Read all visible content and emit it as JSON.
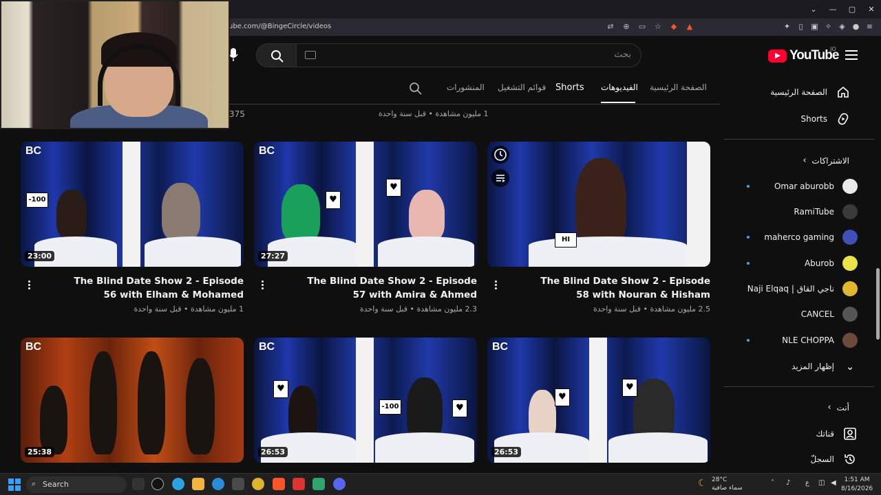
{
  "browser": {
    "url": "ube.com/@BingeCircle/videos",
    "window_controls": [
      "⌄",
      "—",
      "▢",
      "✕"
    ]
  },
  "youtube": {
    "logo_text": "YouTube",
    "country_code": "JO",
    "search_placeholder": "بحث",
    "tabs": [
      {
        "label": "الصفحة الرئيسية",
        "active": false
      },
      {
        "label": "الفيديوهات",
        "active": true
      },
      {
        "label": "Shorts",
        "active": false
      },
      {
        "label": "قوائم التشغيل",
        "active": false
      },
      {
        "label": "المنشورات",
        "active": false
      }
    ],
    "prev_row_meta": "1 مليون مشاهدة • قبل سنة واحدة",
    "prev_row_num": "375"
  },
  "sidebar": {
    "home_label": "الصفحة الرئيسية",
    "shorts_label": "Shorts",
    "subscriptions_header": "الاشتراكات",
    "subscriptions": [
      {
        "name": "Omar aburobb",
        "new": true,
        "color": "#e8e8e8"
      },
      {
        "name": "RamiTube",
        "new": false,
        "color": "#3a3a3a"
      },
      {
        "name": "maherco gaming",
        "new": true,
        "color": "#3f51b5"
      },
      {
        "name": "Aburob",
        "new": true,
        "color": "#e8e34a"
      },
      {
        "name": "Naji Elqaq | ناجي القاق",
        "new": false,
        "color": "#e0b72f"
      },
      {
        "name": "CANCEL",
        "new": false,
        "color": "#555555"
      },
      {
        "name": "NLE CHOPPA",
        "new": true,
        "color": "#6b4a3a"
      }
    ],
    "show_more": "إظهار المزيد",
    "you_header": "أنت",
    "your_channel": "قناتك",
    "history": "السجلّ"
  },
  "videos": [
    {
      "title": "The Blind Date Show 2 - Episode 56 with Elham & Mohamed",
      "meta": "1 مليون مشاهدة • قبل سنة واحدة",
      "duration": "23:00",
      "theme": "blue",
      "sign": "-100"
    },
    {
      "title": "The Blind Date Show 2 - Episode 57 with Amira & Ahmed",
      "meta": "2.3 مليون مشاهدة • قبل سنة واحدة",
      "duration": "27:27",
      "theme": "blue",
      "sign": "♥"
    },
    {
      "title": "The Blind Date Show 2 - Episode 58 with Nouran & Hisham",
      "meta": "2.5 مليون مشاهدة • قبل سنة واحدة",
      "duration": "",
      "theme": "blue",
      "sign": "HI"
    },
    {
      "title": "",
      "meta": "",
      "duration": "25:38",
      "theme": "orange",
      "sign": ""
    },
    {
      "title": "",
      "meta": "",
      "duration": "26:53",
      "theme": "blue",
      "sign": "♥"
    },
    {
      "title": "",
      "meta": "",
      "duration": "26:53",
      "theme": "blue",
      "sign": "♥"
    }
  ],
  "thumb_labels": {
    "bc": "BC",
    "minus100": "-100",
    "heart": "♥",
    "hi": "HI"
  },
  "taskbar": {
    "search_label": "Search",
    "weather_temp": "28°C",
    "weather_cond": "سماء صافية",
    "time": "1:51 AM",
    "date": "8/16/2026",
    "lang": "ع"
  },
  "colors": {
    "accent_red": "#ff0033",
    "new_dot": "#3ea6ff"
  }
}
